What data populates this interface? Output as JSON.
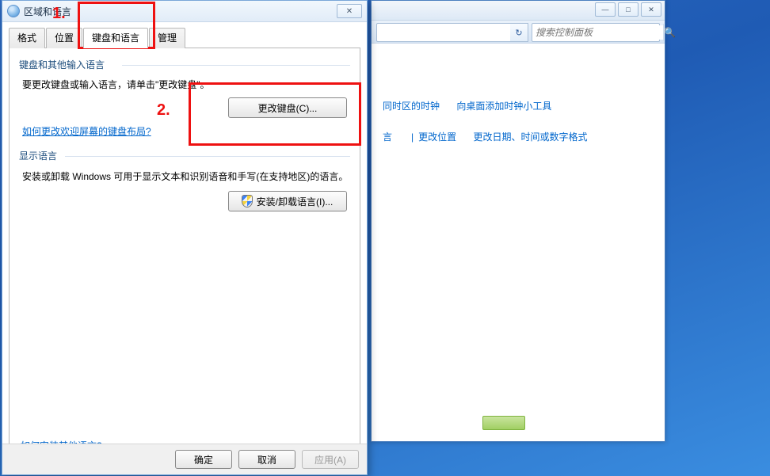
{
  "dialog": {
    "title": "区域和语言",
    "tabs": {
      "format": "格式",
      "location": "位置",
      "keyboard_lang": "键盘和语言",
      "admin": "管理"
    },
    "group1": {
      "heading": "键盘和其他输入语言",
      "desc": "要更改键盘或输入语言，请单击\"更改键盘\"。",
      "change_btn": "更改键盘(C)...",
      "help_link": "如何更改欢迎屏幕的键盘布局?"
    },
    "group2": {
      "heading": "显示语言",
      "desc": "安装或卸载 Windows 可用于显示文本和识别语音和手写(在支持地区)的语言。",
      "install_btn": "安装/卸载语言(I)..."
    },
    "bottom_link": "如何安装其他语言?",
    "footer": {
      "ok": "确定",
      "cancel": "取消",
      "apply": "应用(A)"
    }
  },
  "bg_window": {
    "search_placeholder": "搜索控制面板",
    "links_row1": {
      "a": "同时区的时钟",
      "b": "向桌面添加时钟小工具"
    },
    "links_row2": {
      "a": "言",
      "sep": "|",
      "b": "更改位置",
      "c": "更改日期、时间或数字格式"
    },
    "controls": {
      "min": "—",
      "max": "□",
      "close": "✕",
      "refresh": "↻",
      "search": "🔍"
    }
  },
  "annotations": {
    "one": "1.",
    "two": "2."
  }
}
